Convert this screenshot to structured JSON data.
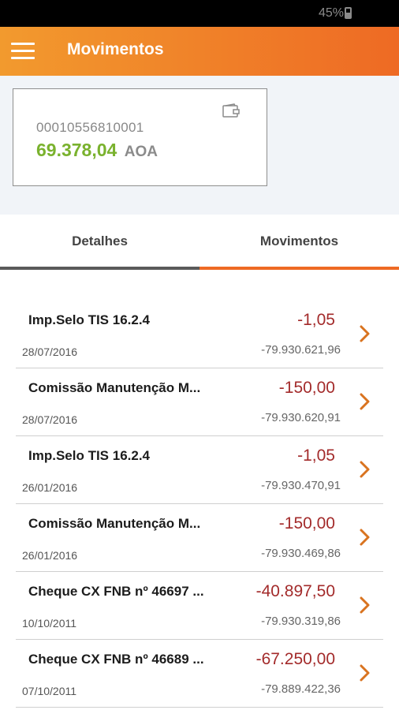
{
  "status_bar": {
    "battery": "45%"
  },
  "app_bar": {
    "title": "Movimentos",
    "menu_icon": "hamburger-menu-icon"
  },
  "account": {
    "number": "00010556810001",
    "balance": "69.378,04",
    "currency": "AOA",
    "icon": "wallet-icon"
  },
  "tabs": [
    {
      "label": "Detalhes",
      "active": false
    },
    {
      "label": "Movimentos",
      "active": true
    }
  ],
  "colors": {
    "brand_orange_start": "#f29a2e",
    "brand_orange_end": "#ee6a24",
    "balance_green": "#7ab22e",
    "debit_red": "#a32b2b"
  },
  "transactions": [
    {
      "description": "Imp.Selo TIS 16.2.4",
      "date": "28/07/2016",
      "amount": "-1,05",
      "balance": "-79.930.621,96"
    },
    {
      "description": "Comissão Manutenção M...",
      "date": "28/07/2016",
      "amount": "-150,00",
      "balance": "-79.930.620,91"
    },
    {
      "description": "Imp.Selo TIS 16.2.4",
      "date": "26/01/2016",
      "amount": "-1,05",
      "balance": "-79.930.470,91"
    },
    {
      "description": "Comissão Manutenção M...",
      "date": "26/01/2016",
      "amount": "-150,00",
      "balance": "-79.930.469,86"
    },
    {
      "description": "Cheque CX FNB nº 46697 ...",
      "date": "10/10/2011",
      "amount": "-40.897,50",
      "balance": "-79.930.319,86"
    },
    {
      "description": "Cheque CX FNB nº 46689 ...",
      "date": "07/10/2011",
      "amount": "-67.250,00",
      "balance": "-79.889.422,36"
    }
  ]
}
